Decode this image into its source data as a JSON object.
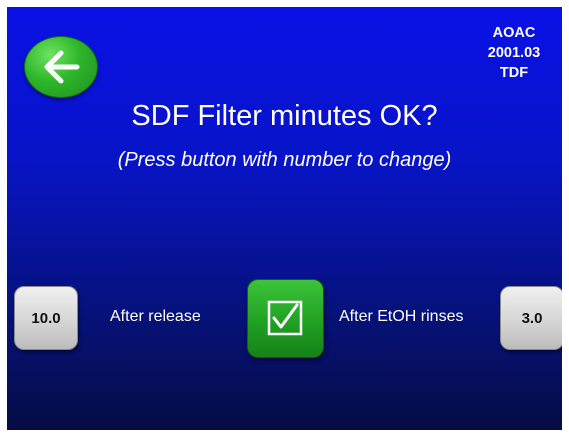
{
  "header": {
    "method_line1": "AOAC",
    "method_line2": "2001.03",
    "method_line3": "TDF"
  },
  "prompt": {
    "title": "SDF Filter minutes OK?",
    "subtitle": "(Press button with number to change)"
  },
  "controls": {
    "left_value": "10.0",
    "left_label": "After release",
    "right_label": "After EtOH rinses",
    "right_value": "3.0"
  },
  "icons": {
    "back": "arrow-left-icon",
    "confirm": "checkbox-check-icon"
  },
  "colors": {
    "background_top": "#0a11e6",
    "background_bottom": "#050c44",
    "button_green": "#1f9d21",
    "button_gray": "#d6d6d6"
  }
}
